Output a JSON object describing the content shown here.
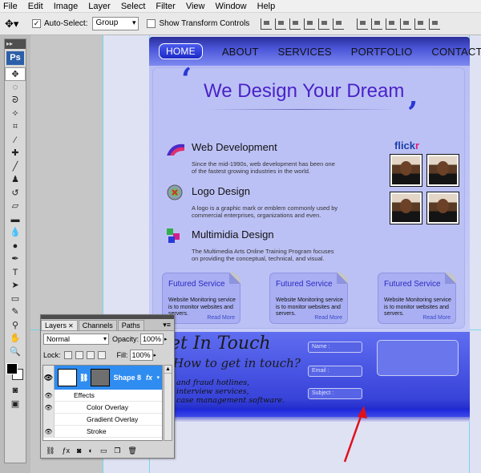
{
  "menubar": [
    "File",
    "Edit",
    "Image",
    "Layer",
    "Select",
    "Filter",
    "View",
    "Window",
    "Help"
  ],
  "options": {
    "auto_select_label": "Auto-Select:",
    "auto_select_value": "Group",
    "transform_label": "Show Transform Controls"
  },
  "tools": {
    "badge": "Ps",
    "grip": "▸▸"
  },
  "site": {
    "nav": [
      "HOME",
      "ABOUT",
      "SERVICES",
      "PORTFOLIO",
      "CONTACT"
    ],
    "open_quote": "‘",
    "close_quote": "’",
    "headline": "We Design Your Dream",
    "services": [
      {
        "title": "Web Development",
        "desc": "Since the mid-1990s, web development has been one of the fastest growing industries in the world."
      },
      {
        "title": "Logo Design",
        "desc": "A logo is a graphic mark or emblem commonly used by commercial enterprises, organizations and even."
      },
      {
        "title": "Multimidia Design",
        "desc": "The Multimedia Arts Online Training Program focuses on providing the conceptual, technical, and visual."
      }
    ],
    "flickr_a": "flick",
    "flickr_b": "r",
    "boxes": [
      {
        "title": "Futured Service",
        "desc": "Website Monitoring service is to monitor websites and servers.",
        "more": "Read More"
      },
      {
        "title": "Futured Service",
        "desc": "Website Monitoring service is to monitor websites and servers.",
        "more": "Read More"
      },
      {
        "title": "Futured Service",
        "desc": "Website Monitoring service is to monitor websites and servers.",
        "more": "Read More"
      }
    ],
    "footer": {
      "title": "et In Touch",
      "question": "How to get in touch?",
      "lines": [
        "and fraud hotlines,",
        "interview services,",
        "case management software."
      ],
      "fields": [
        "Name :",
        "Email :",
        "Subject :"
      ]
    }
  },
  "layers": {
    "tabs": [
      "Layers",
      "Channels",
      "Paths"
    ],
    "blend": "Normal",
    "opacity_label": "Opacity:",
    "opacity": "100%",
    "lock_label": "Lock:",
    "fill_label": "Fill:",
    "fill": "100%",
    "layer_name": "Shape 8",
    "fx": "fx",
    "effects": [
      "Effects",
      "Color Overlay",
      "Gradient Overlay",
      "Stroke"
    ]
  },
  "colors": {
    "accent": "#2f8cf0",
    "annotation": "#e0101a"
  }
}
